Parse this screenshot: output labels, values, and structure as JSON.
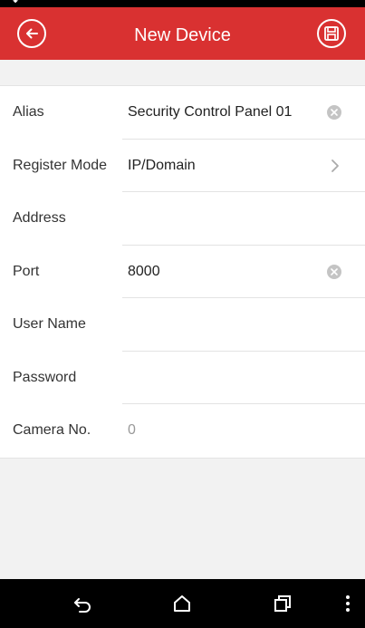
{
  "header": {
    "title": "New Device",
    "back_icon": "back-arrow-icon",
    "save_icon": "save-icon"
  },
  "form": {
    "rows": [
      {
        "label": "Alias",
        "value": "Security Control Panel 01",
        "trailing": "clear"
      },
      {
        "label": "Register Mode",
        "value": "IP/Domain",
        "trailing": "chevron"
      },
      {
        "label": "Address",
        "value": "",
        "trailing": "none"
      },
      {
        "label": "Port",
        "value": "8000",
        "trailing": "clear"
      },
      {
        "label": "User Name",
        "value": "",
        "trailing": "none"
      },
      {
        "label": "Password",
        "value": "",
        "trailing": "none"
      },
      {
        "label": "Camera No.",
        "value": "0",
        "trailing": "none",
        "value_style": "placeholder"
      }
    ]
  },
  "navbar": {
    "icons": [
      "back-icon",
      "home-icon",
      "recents-icon",
      "menu-icon"
    ]
  },
  "colors": {
    "accent": "#d93131",
    "background": "#f2f2f2",
    "nav": "#000000"
  }
}
